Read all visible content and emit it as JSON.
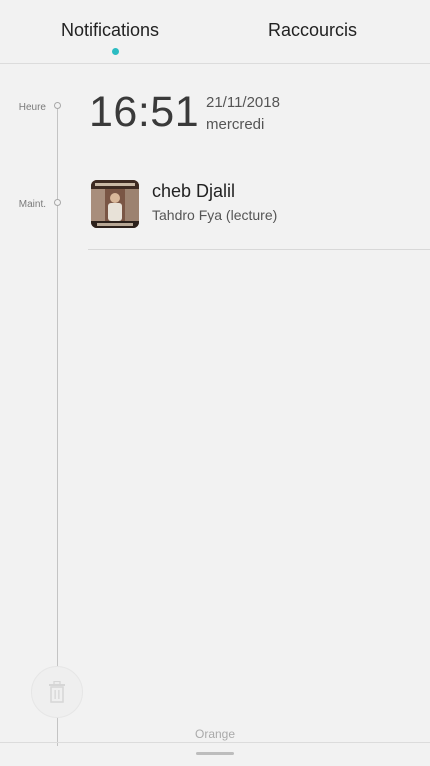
{
  "tabs": {
    "notifications": "Notifications",
    "shortcuts": "Raccourcis",
    "active_indicator_color": "#2cbcc2"
  },
  "timeline": {
    "hour_label": "Heure",
    "now_label": "Maint."
  },
  "clock": {
    "time": "16:51",
    "date": "21/11/2018",
    "weekday": "mercredi"
  },
  "notification": {
    "icon": "album-art-thumbnail",
    "title": "cheb Djalil",
    "subtitle": "Tahdro Fya (lecture)"
  },
  "footer": {
    "clear_icon": "trash-icon",
    "carrier": "Orange",
    "handle_icon": "drag-handle-icon"
  }
}
